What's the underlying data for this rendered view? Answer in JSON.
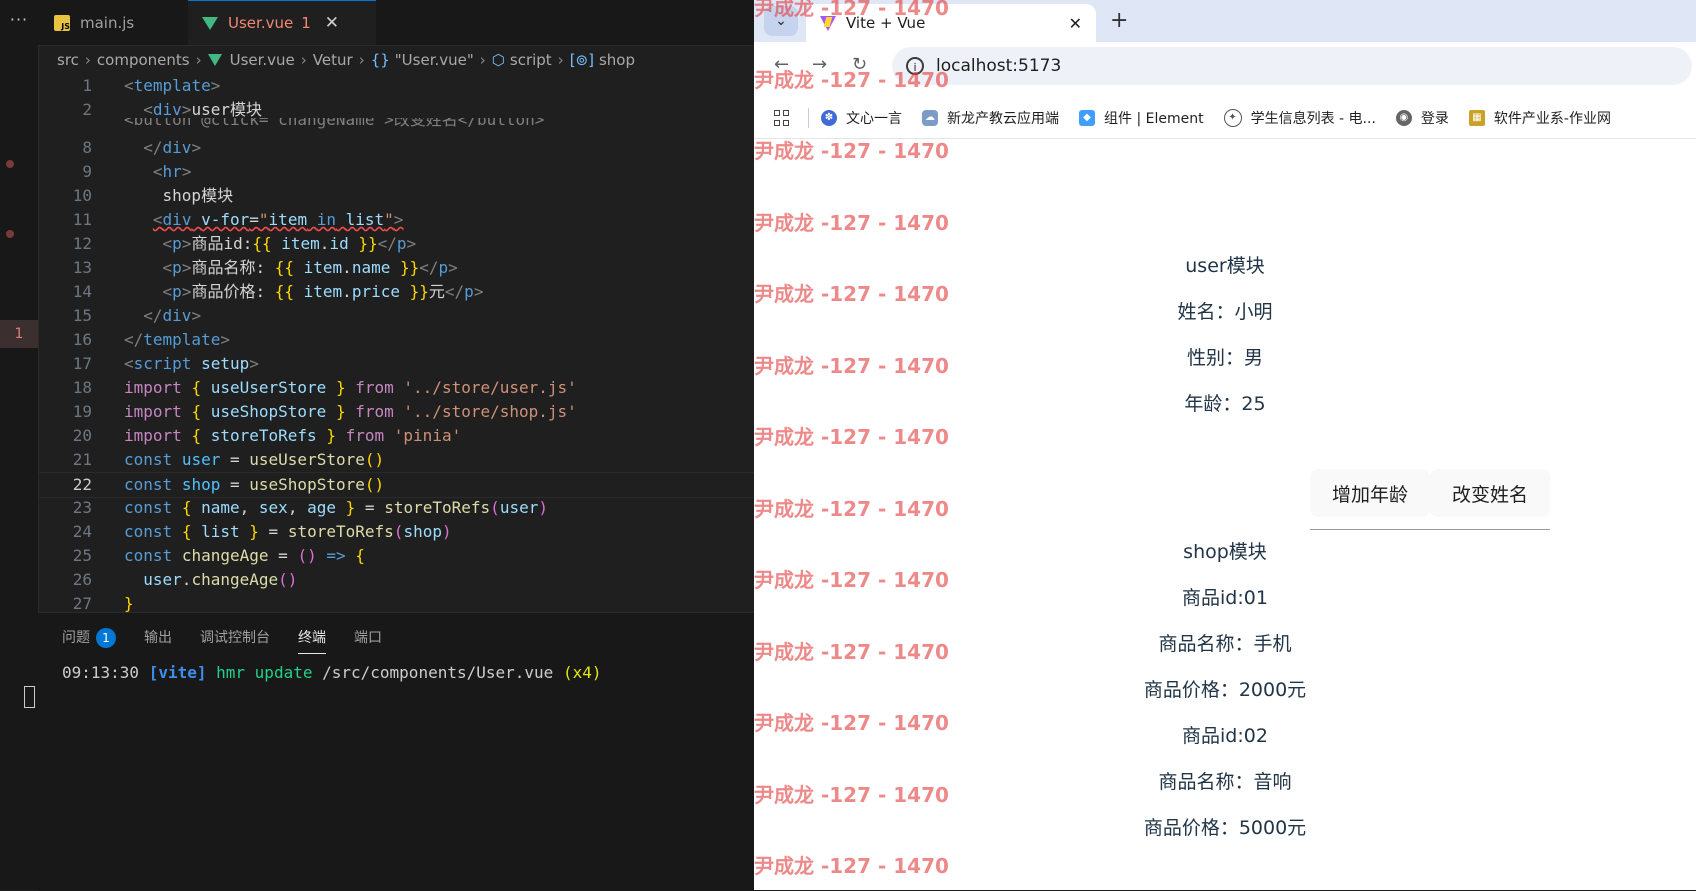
{
  "editor": {
    "tabs": [
      {
        "label": "main.js"
      },
      {
        "label": "User.vue",
        "problems": "1"
      }
    ],
    "breadcrumb": [
      "src",
      "components",
      "User.vue",
      "Vetur",
      "\"User.vue\"",
      "script",
      "shop"
    ],
    "code": [
      {
        "n": "1",
        "html": "<span class='t-br'>&lt;</span><span class='t-tag'>template</span><span class='t-br'>&gt;</span>"
      },
      {
        "n": "2",
        "html": "  <span class='t-br'>&lt;</span><span class='t-tag'>div</span><span class='t-br'>&gt;</span><span class='t-plain'>user模块</span>"
      },
      {
        "n": "8",
        "html": "  <span class='t-br'>&lt;/</span><span class='t-tag'>div</span><span class='t-br'>&gt;</span>"
      },
      {
        "n": "9",
        "html": "   <span class='t-br'>&lt;</span><span class='t-tag'>hr</span><span class='t-br'>&gt;</span>"
      },
      {
        "n": "10",
        "html": "    <span class='t-plain'>shop模块</span>"
      },
      {
        "n": "11",
        "html": "   <span class='squig'><span class='t-br'>&lt;</span><span class='t-tag'>div</span> <span class='t-attr'>v-for</span><span class='t-plain'>=</span><span class='t-str'>\"</span><span class='t-var'>item</span> <span class='t-kw'>in</span> <span class='t-var'>list</span><span class='t-str'>\"</span><span class='t-br'>&gt;</span></span>"
      },
      {
        "n": "12",
        "html": "    <span class='t-br'>&lt;</span><span class='t-tag'>p</span><span class='t-br'>&gt;</span><span class='t-plain'>商品id:</span><span class='t-y'>{{</span> <span class='t-var'>item</span><span class='t-plain'>.</span><span class='t-var'>id</span> <span class='t-y'>}}</span><span class='t-br'>&lt;/</span><span class='t-tag'>p</span><span class='t-br'>&gt;</span>"
      },
      {
        "n": "13",
        "html": "    <span class='t-br'>&lt;</span><span class='t-tag'>p</span><span class='t-br'>&gt;</span><span class='t-plain'>商品名称: </span><span class='t-y'>{{</span> <span class='t-var'>item</span><span class='t-plain'>.</span><span class='t-var'>name</span> <span class='t-y'>}}</span><span class='t-br'>&lt;/</span><span class='t-tag'>p</span><span class='t-br'>&gt;</span>"
      },
      {
        "n": "14",
        "html": "    <span class='t-br'>&lt;</span><span class='t-tag'>p</span><span class='t-br'>&gt;</span><span class='t-plain'>商品价格: </span><span class='t-y'>{{</span> <span class='t-var'>item</span><span class='t-plain'>.</span><span class='t-var'>price</span> <span class='t-y'>}}</span><span class='t-plain'>元</span><span class='t-br'>&lt;/</span><span class='t-tag'>p</span><span class='t-br'>&gt;</span>"
      },
      {
        "n": "15",
        "html": "  <span class='t-br'>&lt;/</span><span class='t-tag'>div</span><span class='t-br'>&gt;</span>"
      },
      {
        "n": "16",
        "html": "<span class='t-br'>&lt;/</span><span class='t-tag'>template</span><span class='t-br'>&gt;</span>"
      },
      {
        "n": "17",
        "html": "<span class='t-br'>&lt;</span><span class='t-tag'>script</span> <span class='t-attr'>setup</span><span class='t-br'>&gt;</span>"
      },
      {
        "n": "18",
        "html": "<span class='t-imp'>import</span> <span class='t-y'>{</span> <span class='t-var'>useUserStore</span> <span class='t-y'>}</span> <span class='t-imp'>from</span> <span class='t-str'>'../store/user.js'</span>"
      },
      {
        "n": "19",
        "html": "<span class='t-imp'>import</span> <span class='t-y'>{</span> <span class='t-var'>useShopStore</span> <span class='t-y'>}</span> <span class='t-imp'>from</span> <span class='t-str'>'../store/shop.js'</span>"
      },
      {
        "n": "20",
        "html": "<span class='t-imp'>import</span> <span class='t-y'>{</span> <span class='t-var'>storeToRefs</span> <span class='t-y'>}</span> <span class='t-imp'>from</span> <span class='t-str'>'pinia'</span>"
      },
      {
        "n": "21",
        "html": "<span class='t-kw'>const</span> <span class='t-const'>user</span> <span class='t-plain'>=</span> <span class='t-fn'>useUserStore</span><span class='t-y'>()</span>"
      },
      {
        "n": "22",
        "html": "<span class='t-kw'>const</span> <span class='t-const'>shop</span> <span class='t-plain'>=</span> <span class='t-fn'>useShopStore</span><span class='t-y'>()</span>",
        "current": true
      },
      {
        "n": "23",
        "html": "<span class='t-kw'>const</span> <span class='t-y'>{</span> <span class='t-var'>name</span><span class='t-plain'>,</span> <span class='t-var'>sex</span><span class='t-plain'>,</span> <span class='t-var'>age</span> <span class='t-y'>}</span> <span class='t-plain'>=</span> <span class='t-fn'>storeToRefs</span><span class='t-p'>(</span><span class='t-var'>user</span><span class='t-p'>)</span>"
      },
      {
        "n": "24",
        "html": "<span class='t-kw'>const</span> <span class='t-y'>{</span> <span class='t-var'>list</span> <span class='t-y'>}</span> <span class='t-plain'>=</span> <span class='t-fn'>storeToRefs</span><span class='t-p'>(</span><span class='t-var'>shop</span><span class='t-p'>)</span>"
      },
      {
        "n": "25",
        "html": "<span class='t-kw'>const</span> <span class='t-fn'>changeAge</span> <span class='t-plain'>=</span> <span class='t-p'>()</span> <span class='t-kw'>=&gt;</span> <span class='t-y'>{</span>"
      },
      {
        "n": "26",
        "html": "  <span class='t-var'>user</span><span class='t-plain'>.</span><span class='t-fn'>changeAge</span><span class='t-p'>()</span>"
      },
      {
        "n": "27",
        "html": "<span class='t-y'>}</span>"
      }
    ],
    "partial_line": "<button @click=\"changeName\">改变姓名</button>",
    "panel_tabs": [
      "问题",
      "输出",
      "调试控制台",
      "终端",
      "端口"
    ],
    "problem_count": "1",
    "terminal": {
      "time": "09:13:30",
      "tag": "[vite]",
      "action": "hmr update",
      "path": "/src/components/User.vue",
      "count": "(x4)"
    },
    "activity_error": "1"
  },
  "browser": {
    "tab_title": "Vite + Vue",
    "url": "localhost:5173",
    "bookmarks": [
      "文心一言",
      "新龙产教云应用端",
      "组件 | Element",
      "学生信息列表 - 电...",
      "登录",
      "软件产业系-作业网"
    ],
    "page": {
      "user_title": "user模块",
      "name_line": "姓名：小明",
      "sex_line": "性别：男",
      "age_line": "年龄：25",
      "btn_add_age": "增加年龄",
      "btn_change_name": "改变姓名",
      "shop_title": "shop模块",
      "items": [
        {
          "id_line": "商品id:01",
          "name_line": "商品名称：手机",
          "price_line": "商品价格：2000元"
        },
        {
          "id_line": "商品id:02",
          "name_line": "商品名称：音响",
          "price_line": "商品价格：5000元"
        }
      ]
    },
    "watermark": "尹成龙 -127 - 1470"
  },
  "colors": {
    "vue_green": "#42b883",
    "watermark": "#e43b3b",
    "accent": "#0078d4"
  }
}
